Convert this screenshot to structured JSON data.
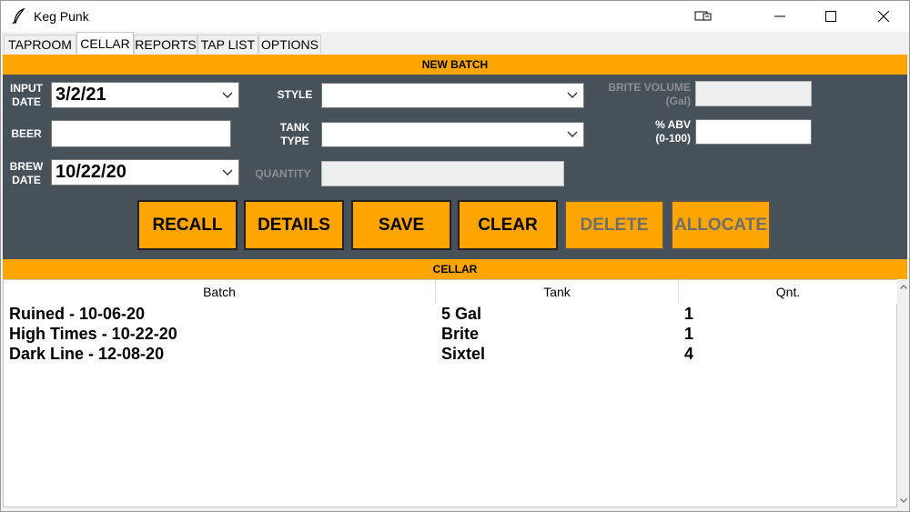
{
  "window": {
    "title": "Keg Punk",
    "icon": "feather-icon"
  },
  "tabs": [
    {
      "label": "TAPROOM"
    },
    {
      "label": "CELLAR"
    },
    {
      "label": "REPORTS"
    },
    {
      "label": "TAP LIST"
    },
    {
      "label": "OPTIONS"
    }
  ],
  "new_batch": {
    "banner": "NEW BATCH",
    "input_date": {
      "label_line1": "INPUT",
      "label_line2": "DATE",
      "value": "3/2/21"
    },
    "beer": {
      "label": "BEER",
      "value": ""
    },
    "brew_date": {
      "label_line1": "BREW",
      "label_line2": "DATE",
      "value": "10/22/20"
    },
    "style": {
      "label": "STYLE",
      "value": ""
    },
    "tank_type": {
      "label_line1": "TANK",
      "label_line2": "TYPE",
      "value": ""
    },
    "quantity": {
      "label": "QUANTITY",
      "value": ""
    },
    "brite_volume": {
      "label_line1": "BRITE VOLUME",
      "label_line2": "(Gal)",
      "value": ""
    },
    "abv": {
      "label_line1": "% ABV",
      "label_line2": "(0-100)",
      "value": ""
    },
    "buttons": {
      "recall": "RECALL",
      "details": "DETAILS",
      "save": "SAVE",
      "clear": "CLEAR",
      "delete": "DELETE",
      "allocate": "ALLOCATE"
    }
  },
  "cellar": {
    "banner": "CELLAR",
    "columns": {
      "batch": "Batch",
      "tank": "Tank",
      "qnt": "Qnt."
    },
    "rows": [
      {
        "batch": "Ruined - 10-06-20",
        "tank": "5 Gal",
        "qnt": "1"
      },
      {
        "batch": "High Times - 10-22-20",
        "tank": "Brite",
        "qnt": "1"
      },
      {
        "batch": "Dark Line - 12-08-20",
        "tank": "Sixtel",
        "qnt": "4"
      }
    ]
  },
  "colors": {
    "accent": "#ffa500",
    "panel": "#46515a"
  }
}
